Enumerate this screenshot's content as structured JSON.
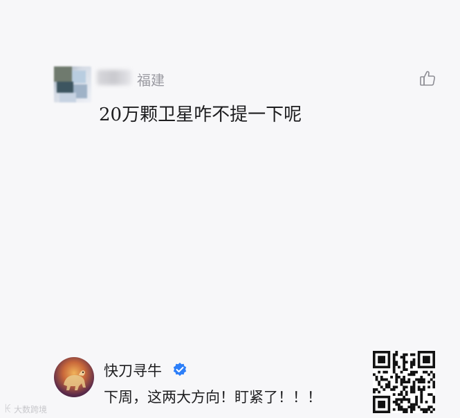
{
  "comment": {
    "location": "福建",
    "text": "20万颗卫星咋不提一下呢"
  },
  "post": {
    "author_name": "快刀寻牛",
    "text": "下周，这两大方向！盯紧了！！！"
  },
  "watermark": "大数跨境",
  "icons": {
    "like": "thumbs-up-icon",
    "verified": "verified-check-icon"
  },
  "colors": {
    "background": "#f7f7f9",
    "text": "#1d1d1f",
    "muted": "#9b9ba2",
    "verified": "#2d7ff9"
  }
}
